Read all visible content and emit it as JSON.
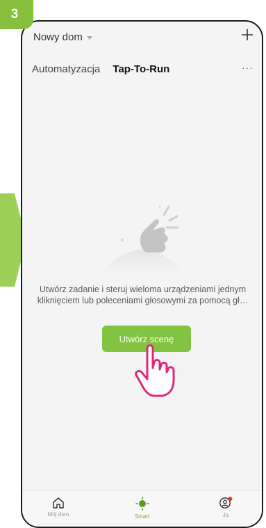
{
  "step": {
    "number": "3"
  },
  "header": {
    "home_name": "Nowy dom",
    "add_icon": "plus-icon"
  },
  "tabs": [
    {
      "label": "Automatyzacja",
      "active": false
    },
    {
      "label": "Tap-To-Run",
      "active": true
    }
  ],
  "more_label": "···",
  "empty_state": {
    "message": "Utwórz zadanie i steruj wieloma urządzeniami jednym kliknięciem lub poleceniami głosowymi za pomocą gł…",
    "button_label": "Utwórz scenę"
  },
  "bottom_nav": [
    {
      "label": "Mój dom",
      "icon": "home-icon",
      "active": false
    },
    {
      "label": "Smart",
      "icon": "smart-icon",
      "active": true
    },
    {
      "label": "Ja",
      "icon": "profile-icon",
      "active": false
    }
  ],
  "colors": {
    "accent": "#82c342",
    "step_badge": "#86bf3c",
    "arrow": "#9ccf55",
    "notification_dot": "#e53935"
  }
}
